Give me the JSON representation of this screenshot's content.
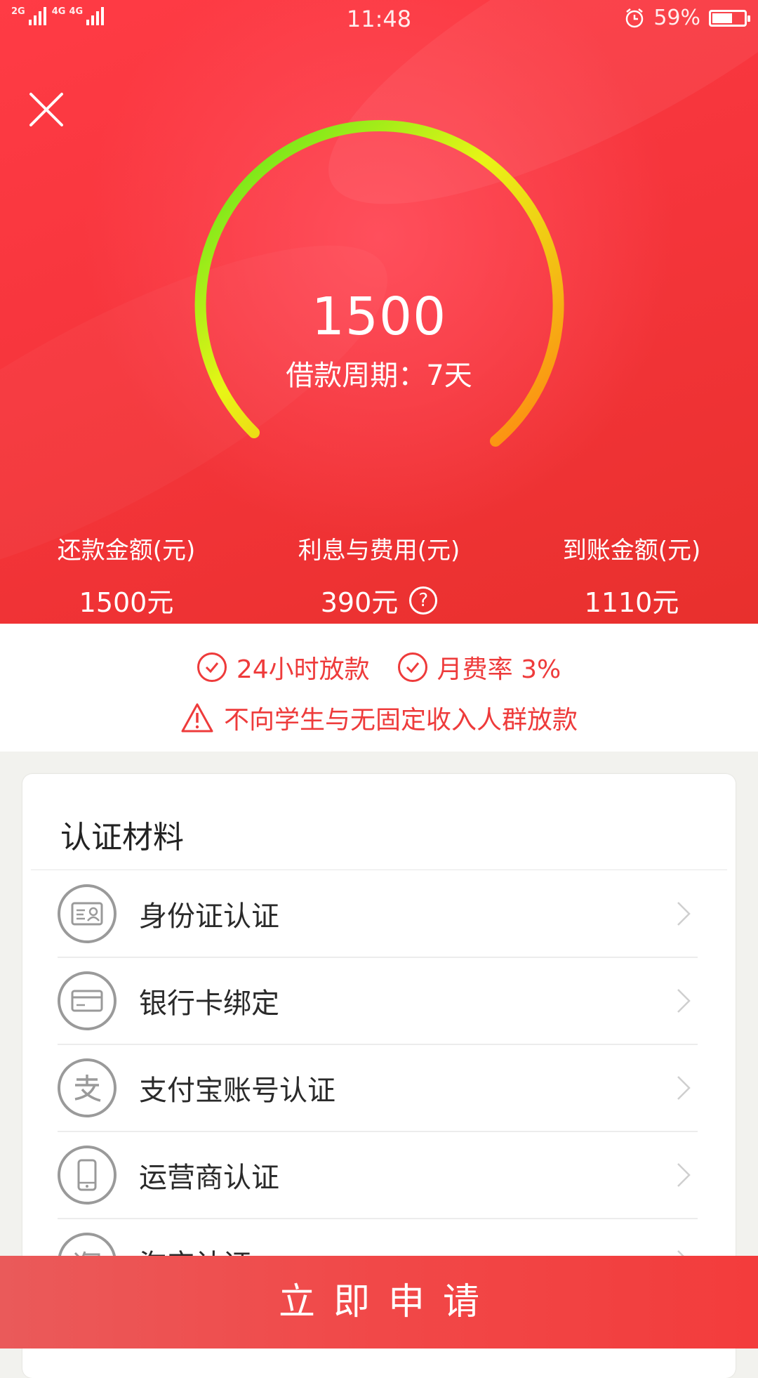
{
  "status_bar": {
    "signal1_label": "2G",
    "signal2_label": "4G",
    "signal3_label": "4G",
    "time": "11:48",
    "battery": "59%"
  },
  "loan": {
    "amount": "1500",
    "period_label": "借款周期：",
    "period_value": "7天"
  },
  "stats": [
    {
      "label": "还款金额(元)",
      "value": "1500元"
    },
    {
      "label": "利息与费用(元)",
      "value": "390元"
    },
    {
      "label": "到账金额(元)",
      "value": "1110元"
    }
  ],
  "notices": {
    "feature1": "24小时放款",
    "feature2": "月费率 3%",
    "warning": "不向学生与无固定收入人群放款"
  },
  "verification": {
    "title": "认证材料",
    "items": [
      {
        "label": "身份证认证",
        "icon": "id-card-icon"
      },
      {
        "label": "银行卡绑定",
        "icon": "bank-card-icon"
      },
      {
        "label": "支付宝账号认证",
        "icon": "alipay-icon"
      },
      {
        "label": "运营商认证",
        "icon": "phone-icon"
      },
      {
        "label": "淘宝认证",
        "icon": "taobao-icon"
      }
    ]
  },
  "apply_button": "立即申请",
  "colors": {
    "primary_red": "#f6353c",
    "notice_red": "#ee3b3b",
    "gauge_start": "#5be31a",
    "gauge_mid": "#e7f516",
    "gauge_end": "#ff8a12"
  }
}
